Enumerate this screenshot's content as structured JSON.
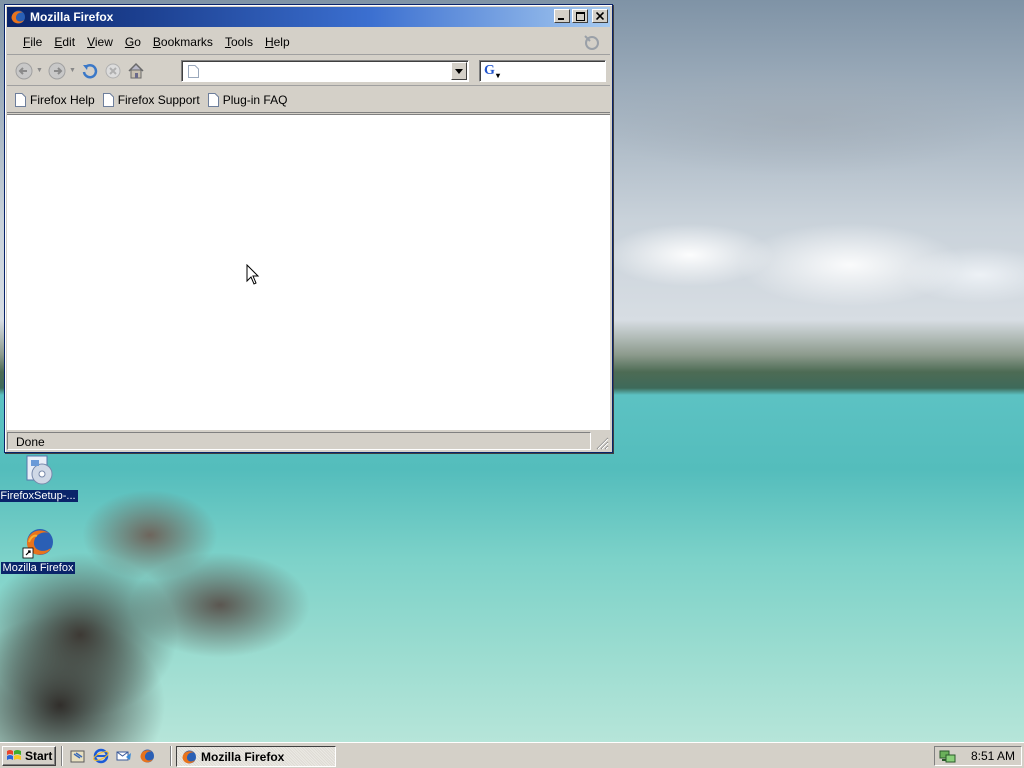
{
  "window": {
    "title": "Mozilla Firefox",
    "buttons": {
      "minimize": "_",
      "maximize": "□",
      "close": "✕"
    }
  },
  "menu": {
    "items": [
      {
        "label": "File",
        "accel": "F",
        "rest": "ile"
      },
      {
        "label": "Edit",
        "accel": "E",
        "rest": "dit"
      },
      {
        "label": "View",
        "accel": "V",
        "rest": "iew"
      },
      {
        "label": "Go",
        "accel": "G",
        "rest": "o"
      },
      {
        "label": "Bookmarks",
        "accel": "B",
        "rest": "ookmarks"
      },
      {
        "label": "Tools",
        "accel": "T",
        "rest": "ools"
      },
      {
        "label": "Help",
        "accel": "H",
        "rest": "elp"
      }
    ]
  },
  "nav": {
    "url_value": "",
    "search_value": "",
    "search_engine": "G"
  },
  "bookmarks": {
    "items": [
      "Firefox Help",
      "Firefox Support",
      "Plug-in FAQ"
    ]
  },
  "status": {
    "text": "Done"
  },
  "desktop": {
    "icons": [
      {
        "label": "FirefoxSetup-..."
      },
      {
        "label": "Mozilla Firefox"
      }
    ]
  },
  "taskbar": {
    "start_label": "Start",
    "tasks": [
      {
        "label": "Mozilla Firefox"
      }
    ],
    "clock": "8:51 AM"
  },
  "colors": {
    "titlebar_start": "#0a246a",
    "titlebar_end": "#a6caf0",
    "chrome": "#d4d0c8"
  }
}
